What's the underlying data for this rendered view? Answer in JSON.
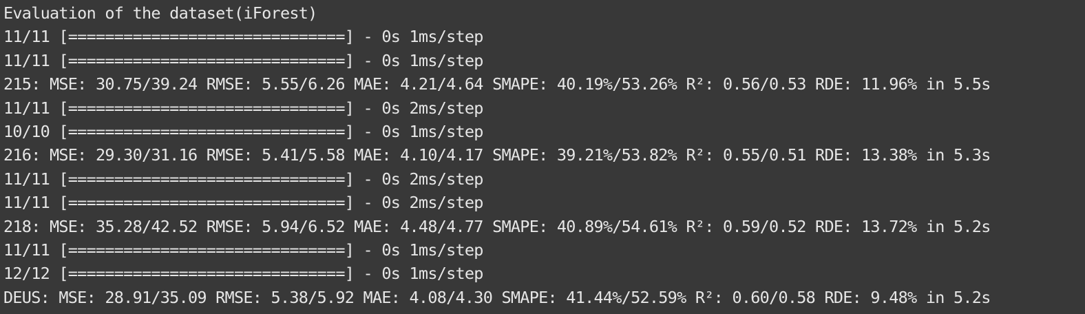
{
  "terminal": {
    "lines": [
      "Evaluation of the dataset(iForest)",
      "11/11 [==============================] - 0s 1ms/step",
      "11/11 [==============================] - 0s 1ms/step",
      "215: MSE: 30.75/39.24 RMSE: 5.55/6.26 MAE: 4.21/4.64 SMAPE: 40.19%/53.26% R²: 0.56/0.53 RDE: 11.96% in 5.5s",
      "11/11 [==============================] - 0s 2ms/step",
      "10/10 [==============================] - 0s 1ms/step",
      "216: MSE: 29.30/31.16 RMSE: 5.41/5.58 MAE: 4.10/4.17 SMAPE: 39.21%/53.82% R²: 0.55/0.51 RDE: 13.38% in 5.3s",
      "11/11 [==============================] - 0s 2ms/step",
      "11/11 [==============================] - 0s 2ms/step",
      "218: MSE: 35.28/42.52 RMSE: 5.94/6.52 MAE: 4.48/4.77 SMAPE: 40.89%/54.61% R²: 0.59/0.52 RDE: 13.72% in 5.2s",
      "11/11 [==============================] - 0s 1ms/step",
      "12/12 [==============================] - 0s 1ms/step",
      "DEUS: MSE: 28.91/35.09 RMSE: 5.38/5.92 MAE: 4.08/4.30 SMAPE: 41.44%/52.59% R²: 0.60/0.58 RDE: 9.48% in 5.2s"
    ],
    "colors": {
      "background": "#383838",
      "text": "#e6e6e6"
    }
  }
}
